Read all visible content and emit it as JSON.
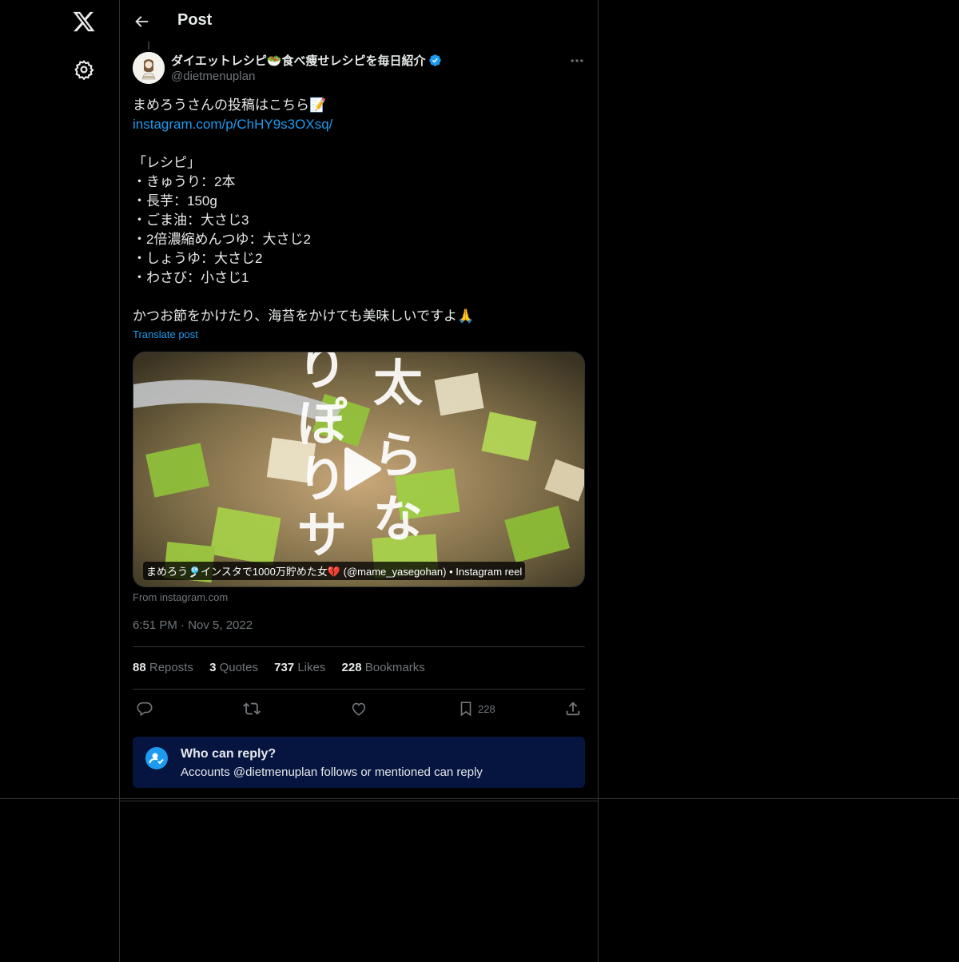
{
  "header": {
    "title": "Post"
  },
  "nav": {
    "logo_icon": "x-logo-icon",
    "settings_icon": "gear-icon"
  },
  "post": {
    "author_name": "ダイエットレシピ🥗食べ痩せレシピを毎日紹介",
    "author_handle": "@dietmenuplan",
    "lines": [
      "まめろうさんの投稿はこちら📝",
      "instagram.com/p/ChHY9s3OXsq/",
      "",
      "「レシピ」",
      "・きゅうり：2本",
      "・長芋：150g",
      "・ごま油：大さじ3",
      "・2倍濃縮めんつゆ：大さじ2",
      "・しょうゆ：大さじ2",
      "・わさび：小さじ1",
      "",
      "かつお節をかけたり、海苔をかけても美味しいですよ🙏"
    ],
    "translate_label": "Translate post",
    "media_caption": "まめろう🎐インスタで1000万貯めた女💔 (@mame_yasegohan) • Instagram reel",
    "media_source": "From instagram.com",
    "timestamp": "6:51 PM · Nov 5, 2022"
  },
  "stats": {
    "reposts_count": "88",
    "reposts_label": "Reposts",
    "quotes_count": "3",
    "quotes_label": "Quotes",
    "likes_count": "737",
    "likes_label": "Likes",
    "bookmarks_count": "228",
    "bookmarks_label": "Bookmarks"
  },
  "actions": {
    "bookmark_count": "228"
  },
  "reply_box": {
    "title": "Who can reply?",
    "subtitle": "Accounts @dietmenuplan follows or mentioned can reply"
  },
  "colors": {
    "accent": "#1d9bf0",
    "background": "#000000",
    "reply_box_bg": "#061540",
    "muted": "#71767b"
  }
}
